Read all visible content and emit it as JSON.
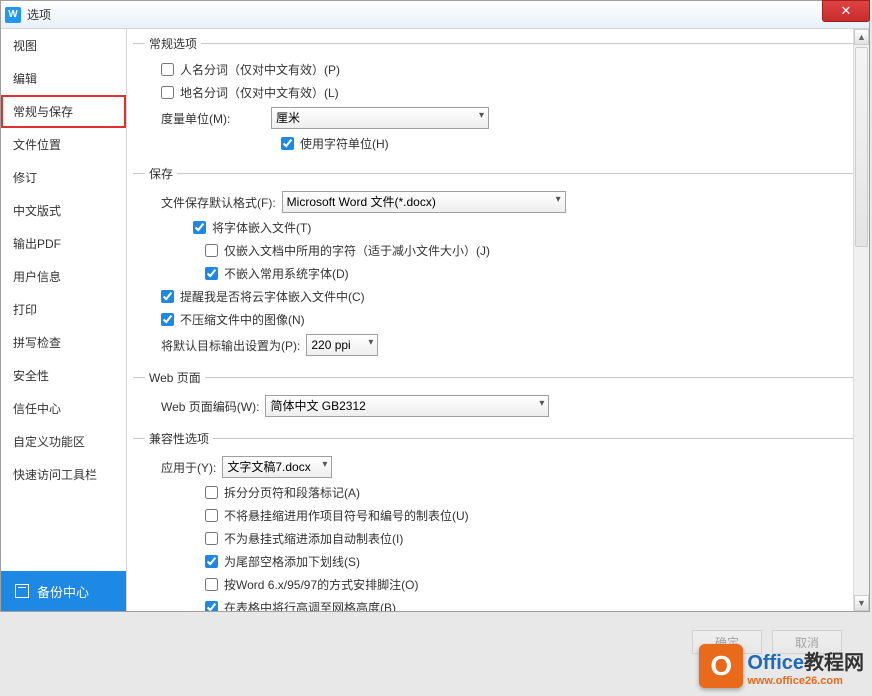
{
  "window": {
    "title": "选项"
  },
  "close": "✕",
  "sidebar": {
    "items": [
      {
        "label": "视图",
        "sel": false
      },
      {
        "label": "编辑",
        "sel": false
      },
      {
        "label": "常规与保存",
        "sel": true
      },
      {
        "label": "文件位置",
        "sel": false
      },
      {
        "label": "修订",
        "sel": false
      },
      {
        "label": "中文版式",
        "sel": false
      },
      {
        "label": "输出PDF",
        "sel": false
      },
      {
        "label": "用户信息",
        "sel": false
      },
      {
        "label": "打印",
        "sel": false
      },
      {
        "label": "拼写检查",
        "sel": false
      },
      {
        "label": "安全性",
        "sel": false
      },
      {
        "label": "信任中心",
        "sel": false
      },
      {
        "label": "自定义功能区",
        "sel": false
      },
      {
        "label": "快速访问工具栏",
        "sel": false
      }
    ],
    "backup": "备份中心"
  },
  "groups": {
    "general": {
      "legend": "常规选项",
      "personName": "人名分词（仅对中文有效）(P)",
      "placeName": "地名分词（仅对中文有效）(L)",
      "unitLabel": "度量单位(M):",
      "unitValue": "厘米",
      "useCharUnit": "使用字符单位(H)"
    },
    "save": {
      "legend": "保存",
      "defaultFormatLabel": "文件保存默认格式(F):",
      "defaultFormatValue": "Microsoft Word 文件(*.docx)",
      "embedFonts": "将字体嵌入文件(T)",
      "embedOnlyUsed": "仅嵌入文档中所用的字符（适于减小文件大小）(J)",
      "skipSystemFonts": "不嵌入常用系统字体(D)",
      "promptCloud": "提醒我是否将云字体嵌入文件中(C)",
      "noCompressImg": "不压缩文件中的图像(N)",
      "targetPpiLabel": "将默认目标输出设置为(P):",
      "targetPpiValue": "220 ppi"
    },
    "web": {
      "legend": "Web 页面",
      "encodingLabel": "Web 页面编码(W):",
      "encodingValue": "简体中文 GB2312"
    },
    "compat": {
      "legend": "兼容性选项",
      "applyToLabel": "应用于(Y):",
      "applyToValue": "文字文稿7.docx",
      "opts": [
        {
          "label": "拆分分页符和段落标记(A)",
          "chk": false
        },
        {
          "label": "不将悬挂缩进用作项目符号和编号的制表位(U)",
          "chk": false
        },
        {
          "label": "不为悬挂式缩进添加自动制表位(I)",
          "chk": false
        },
        {
          "label": "为尾部空格添加下划线(S)",
          "chk": true
        },
        {
          "label": "按Word 6.x/95/97的方式安排脚注(O)",
          "chk": false
        },
        {
          "label": "在表格中将行高调至网格高度(B)",
          "chk": true
        }
      ]
    }
  },
  "buttons": {
    "ok": "确定",
    "cancel": "取消"
  },
  "watermark": {
    "big": "Office",
    "suffix": "教程网",
    "url": "www.office26.com"
  }
}
